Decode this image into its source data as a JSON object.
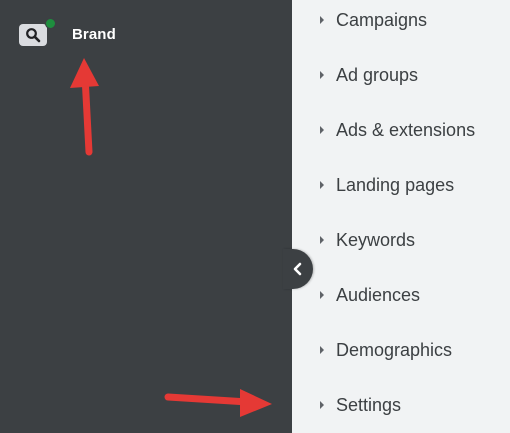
{
  "account": {
    "name": "Brand",
    "search_icon": "search-icon",
    "status_color": "#1e8e3e"
  },
  "collapse_button": {
    "icon": "chevron-left-icon"
  },
  "nav": {
    "items": [
      {
        "label": "Campaigns"
      },
      {
        "label": "Ad groups"
      },
      {
        "label": "Ads & extensions"
      },
      {
        "label": "Landing pages"
      },
      {
        "label": "Keywords"
      },
      {
        "label": "Audiences"
      },
      {
        "label": "Demographics"
      },
      {
        "label": "Settings"
      }
    ]
  },
  "annotations": {
    "arrow_color": "#e53935"
  },
  "colors": {
    "sidebar_bg": "#3c4043",
    "menu_bg": "#f1f3f4",
    "text": "#3c4043"
  }
}
